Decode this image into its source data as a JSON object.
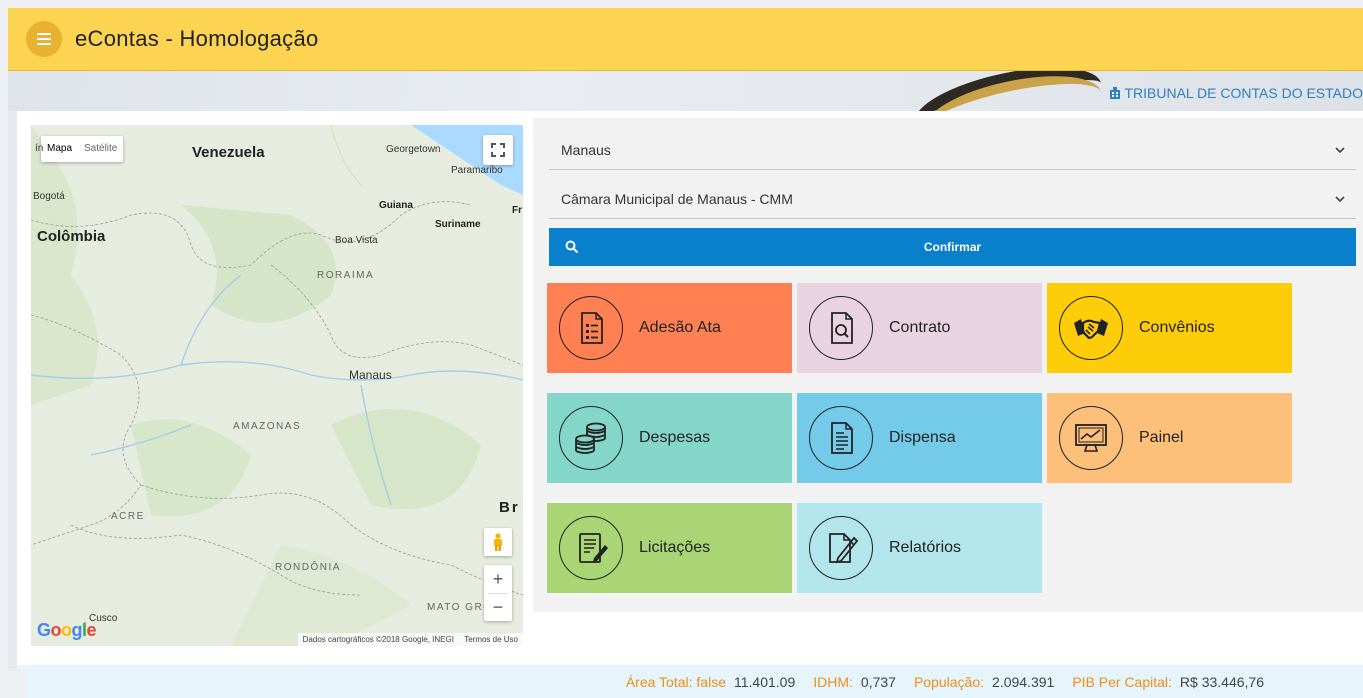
{
  "app": {
    "title": "eContas - Homologação"
  },
  "banner": {
    "org_name": "TRIBUNAL DE CONTAS DO ESTADO"
  },
  "map": {
    "type_options": [
      "Mapa",
      "Satélite"
    ],
    "selected_type": "Mapa",
    "labels": {
      "venezuela": "Venezuela",
      "colombia": "Colômbia",
      "bogota": "Bogotá",
      "georgetown": "Georgetown",
      "paramaribo": "Paramaribo",
      "guiana": "Guiana",
      "suriname": "Suriname",
      "boa_vista": "Boa Vista",
      "roraima": "RORAIMA",
      "manaus": "Manaus",
      "amazonas": "AMAZONAS",
      "acre": "ACRE",
      "rondonia": "RONDÔNIA",
      "mato_grosso": "MATO GRO",
      "cusco": "Cusco",
      "brasil": "Br",
      "fr": "Fr",
      "edge_left": "ín"
    },
    "attribution": "Dados cartográficos ©2018 Google, INEGI",
    "terms": "Termos de Uso",
    "logo": "Google"
  },
  "filters": {
    "municipio": "Manaus",
    "entidade": "Câmara Municipal de Manaus - CMM",
    "confirm_label": "Confirmar"
  },
  "tiles": [
    {
      "label": "Adesão Ata",
      "color": "#ff8153",
      "icon": "document-list-icon"
    },
    {
      "label": "Contrato",
      "color": "#e9d3e1",
      "icon": "document-search-icon"
    },
    {
      "label": "Convênios",
      "color": "#fecd0a",
      "icon": "handshake-icon"
    },
    {
      "label": "Despesas",
      "color": "#84d6c8",
      "icon": "coins-icon"
    },
    {
      "label": "Dispensa",
      "color": "#74cae9",
      "icon": "document-text-icon"
    },
    {
      "label": "Painel",
      "color": "#fcc07a",
      "icon": "monitor-chart-icon"
    },
    {
      "label": "Licitações",
      "color": "#a9d575",
      "icon": "document-edit-icon"
    },
    {
      "label": "Relatórios",
      "color": "#b2e5ec",
      "icon": "report-pencil-icon"
    }
  ],
  "footer": {
    "area_label": "Área Total: false",
    "area_value": "11.401.09",
    "idhm_label": "IDHM:",
    "idhm_value": "0,737",
    "pop_label": "População:",
    "pop_value": "2.094.391",
    "pib_label": "PIB Per Capital:",
    "pib_value": "R$ 33.446,76"
  }
}
